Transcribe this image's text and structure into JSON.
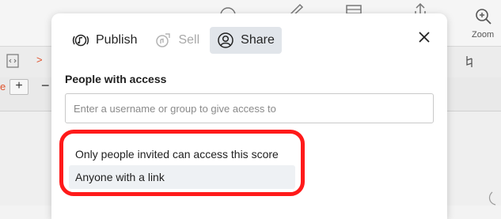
{
  "background": {
    "zoom_label": "Zoom",
    "left_marker_1": ">",
    "left_marker_2": "e",
    "plus_label": "+",
    "minus_label": "−"
  },
  "dialog": {
    "tabs": [
      {
        "label": "Publish",
        "icon": "music-note-icon",
        "state": "normal"
      },
      {
        "label": "Sell",
        "icon": "sell-tag-icon",
        "state": "disabled"
      },
      {
        "label": "Share",
        "icon": "person-icon",
        "state": "selected"
      }
    ],
    "close_icon": "close-icon",
    "people_label": "People with access",
    "input": {
      "placeholder": "Enter a username or group to give access to",
      "value": ""
    },
    "access_options": [
      {
        "label": "Only people invited can access this score",
        "hovered": false
      },
      {
        "label": "Anyone with a link",
        "hovered": true
      }
    ]
  },
  "colors": {
    "highlight": "#ff1a1a",
    "active_tab": "#e1e5ea",
    "hovered_option": "#eef1f4"
  }
}
